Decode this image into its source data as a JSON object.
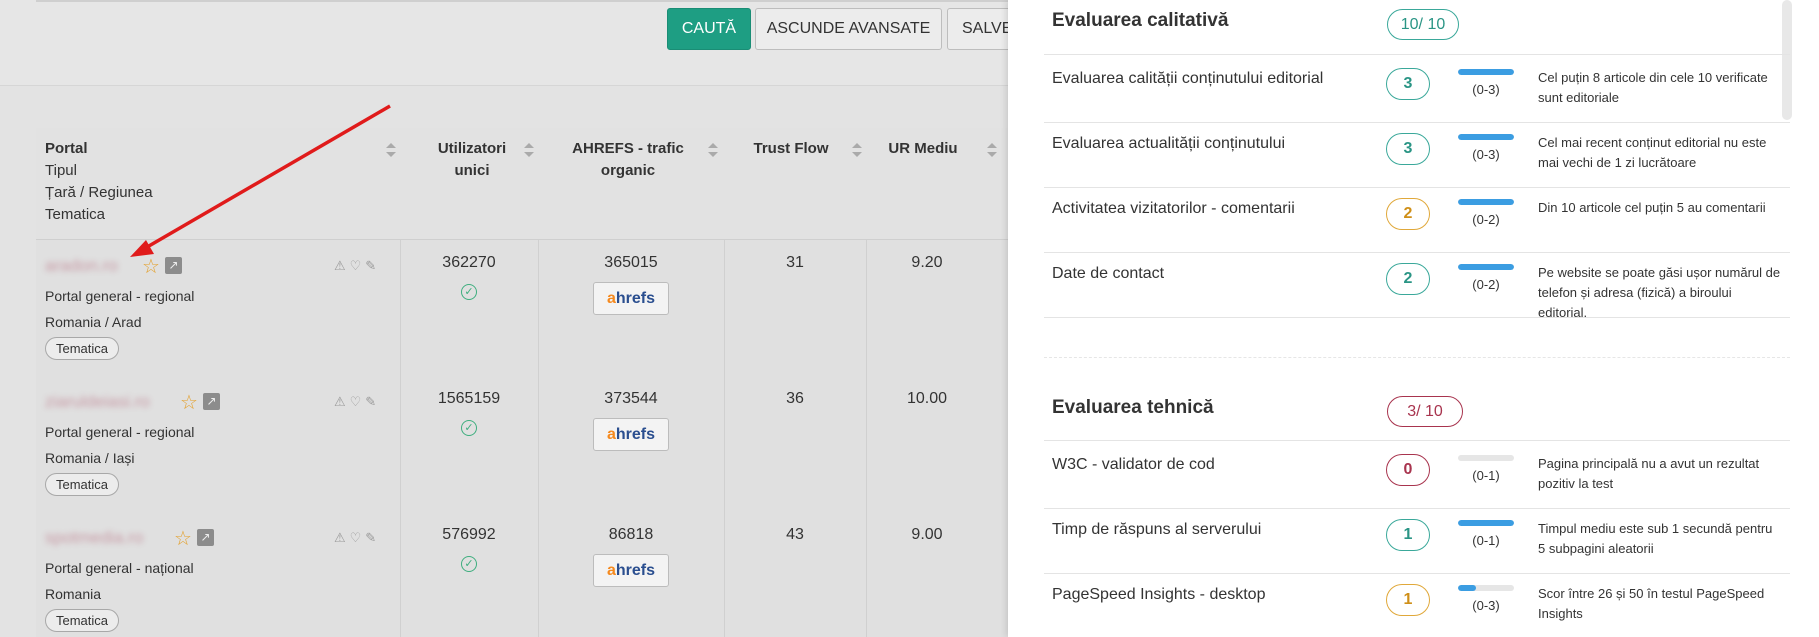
{
  "toolbar": {
    "search_label": "CAUTĂ",
    "hide_advanced_label": "ASCUNDE AVANSATE",
    "save_label": "SALVE"
  },
  "table": {
    "headers": {
      "portal": "Portal",
      "portal_sub": [
        "Tipul",
        "Țară / Regiunea",
        "Tematica"
      ],
      "users": "Utilizatori unici",
      "ahrefs": "AHREFS - trafic organic",
      "trust_flow": "Trust Flow",
      "ur": "UR Mediu"
    },
    "rows": [
      {
        "site": "aradon.ro",
        "type": "Portal general - regional",
        "location": "Romania / Arad",
        "tag": "Tematica",
        "users": "362270",
        "ahrefs": "365015",
        "trust_flow": "31",
        "ur": "9.20"
      },
      {
        "site": "ziaruldeiasi.ro",
        "type": "Portal general - regional",
        "location": "Romania / Iași",
        "tag": "Tematica",
        "users": "1565159",
        "ahrefs": "373544",
        "trust_flow": "36",
        "ur": "10.00"
      },
      {
        "site": "spotmedia.ro",
        "type": "Portal general - național",
        "location": "Romania",
        "tag": "Tematica",
        "users": "576992",
        "ahrefs": "86818",
        "trust_flow": "43",
        "ur": "9.00"
      }
    ],
    "ahrefs_logo": {
      "a": "a",
      "rest": "hrefs"
    }
  },
  "panel": {
    "qualitative": {
      "title": "Evaluarea calitativă",
      "score": "10/ 10",
      "items": [
        {
          "label": "Evaluarea calității conținutului editorial",
          "value": "3",
          "range": "(0-3)",
          "level": 1.0,
          "note": "Cel puțin 8 articole din cele 10 verificate sunt editoriale"
        },
        {
          "label": "Evaluarea actualității conținutului",
          "value": "3",
          "range": "(0-3)",
          "level": 1.0,
          "note": "Cel mai recent conținut editorial nu este mai vechi de 1 zi lucrătoare"
        },
        {
          "label": "Activitatea vizitatorilor - comentarii",
          "value": "2",
          "range": "(0-2)",
          "level": 1.0,
          "note": "Din 10 articole cel puțin 5 au comentarii"
        },
        {
          "label": "Date de contact",
          "value": "2",
          "range": "(0-2)",
          "level": 1.0,
          "note": "Pe website se poate găsi ușor numărul de telefon și adresa (fizică) a biroului editorial."
        }
      ]
    },
    "technical": {
      "title": "Evaluarea tehnică",
      "score": "3/ 10",
      "items": [
        {
          "label": "W3C - validator de cod",
          "value": "0",
          "range": "(0-1)",
          "level": 0.0,
          "note": "Pagina principală nu a avut un rezultat pozitiv la test"
        },
        {
          "label": "Timp de răspuns al serverului",
          "value": "1",
          "range": "(0-1)",
          "level": 1.0,
          "note": "Timpul mediu este sub 1 secundă pentru 5 subpagini aleatorii"
        },
        {
          "label": "PageSpeed Insights - desktop",
          "value": "1",
          "range": "(0-3)",
          "level": 0.33,
          "note": "Scor între 26 și 50 în testul PageSpeed Insights"
        }
      ]
    }
  },
  "colors": {
    "accent": "#1e9e83",
    "bar_fill": "#3b9de2",
    "green": "#3aa89a",
    "orange": "#e0a83a",
    "red": "#a8344e",
    "arrow": "#e01b1b"
  }
}
